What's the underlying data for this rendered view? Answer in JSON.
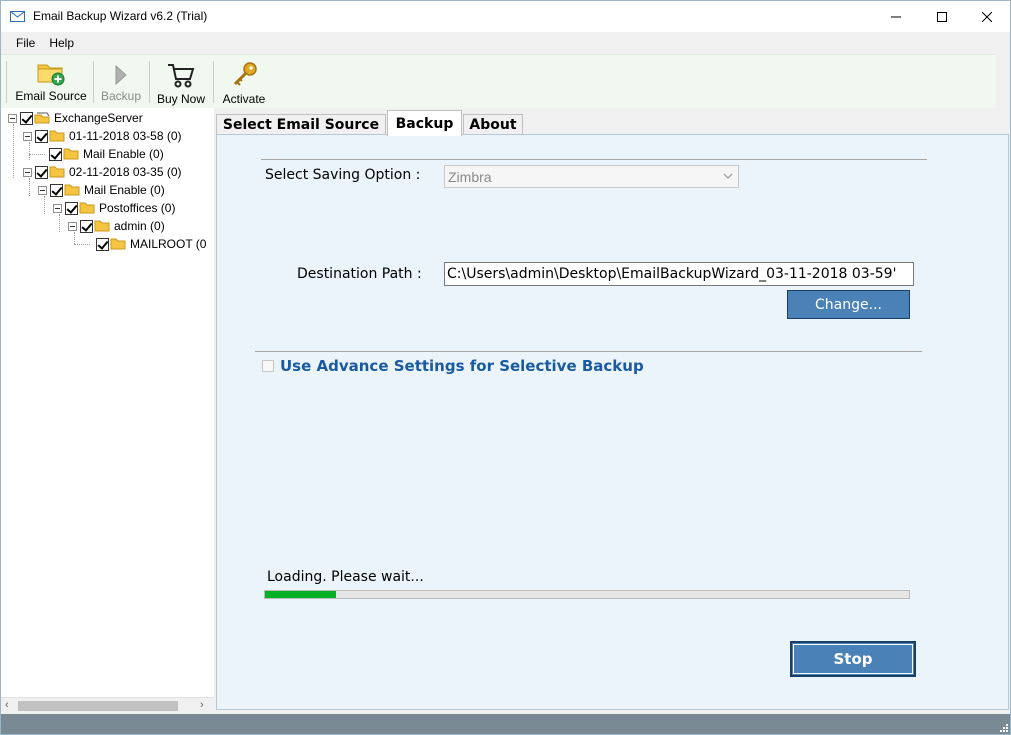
{
  "window": {
    "title": "Email Backup Wizard v6.2 (Trial)",
    "controls": [
      "minimize",
      "maximize",
      "close"
    ]
  },
  "menu": {
    "items": [
      "File",
      "Help"
    ]
  },
  "toolbar": {
    "email_source": "Email Source",
    "backup": "Backup",
    "buy_now": "Buy Now",
    "activate": "Activate"
  },
  "tree": {
    "nodes": [
      {
        "label": "ExchangeServer",
        "checked": true,
        "icon": "server-icon"
      },
      {
        "label": "01-11-2018 03-58 (0)",
        "checked": true,
        "icon": "folder-icon"
      },
      {
        "label": "Mail Enable (0)",
        "checked": true,
        "icon": "folder-icon"
      },
      {
        "label": "02-11-2018 03-35 (0)",
        "checked": true,
        "icon": "folder-icon"
      },
      {
        "label": "Mail Enable (0)",
        "checked": true,
        "icon": "folder-icon"
      },
      {
        "label": "Postoffices (0)",
        "checked": true,
        "icon": "folder-icon"
      },
      {
        "label": "admin (0)",
        "checked": true,
        "icon": "folder-icon"
      },
      {
        "label": "MAILROOT (0",
        "checked": true,
        "icon": "folder-icon"
      }
    ]
  },
  "tabs": [
    {
      "label": "Select Email Source",
      "active": false
    },
    {
      "label": "Backup",
      "active": true
    },
    {
      "label": "About",
      "active": false
    }
  ],
  "backup": {
    "saving_option_label": "Select Saving Option :",
    "saving_option_value": "Zimbra",
    "destination_label": "Destination Path :",
    "destination_value": "C:\\Users\\admin\\Desktop\\EmailBackupWizard_03-11-2018 03-59'",
    "change_button": "Change...",
    "advance_settings_label": "Use Advance Settings for Selective Backup",
    "advance_settings_checked": false,
    "loading_text": "Loading. Please wait...",
    "progress_percent": 11,
    "stop_button": "Stop"
  },
  "colors": {
    "accent": "#4a82b8",
    "progress": "#06b025",
    "advance_label": "#1a5aa0",
    "panel_bg": "#ebf4fb",
    "status_bar": "#7a8a94"
  }
}
